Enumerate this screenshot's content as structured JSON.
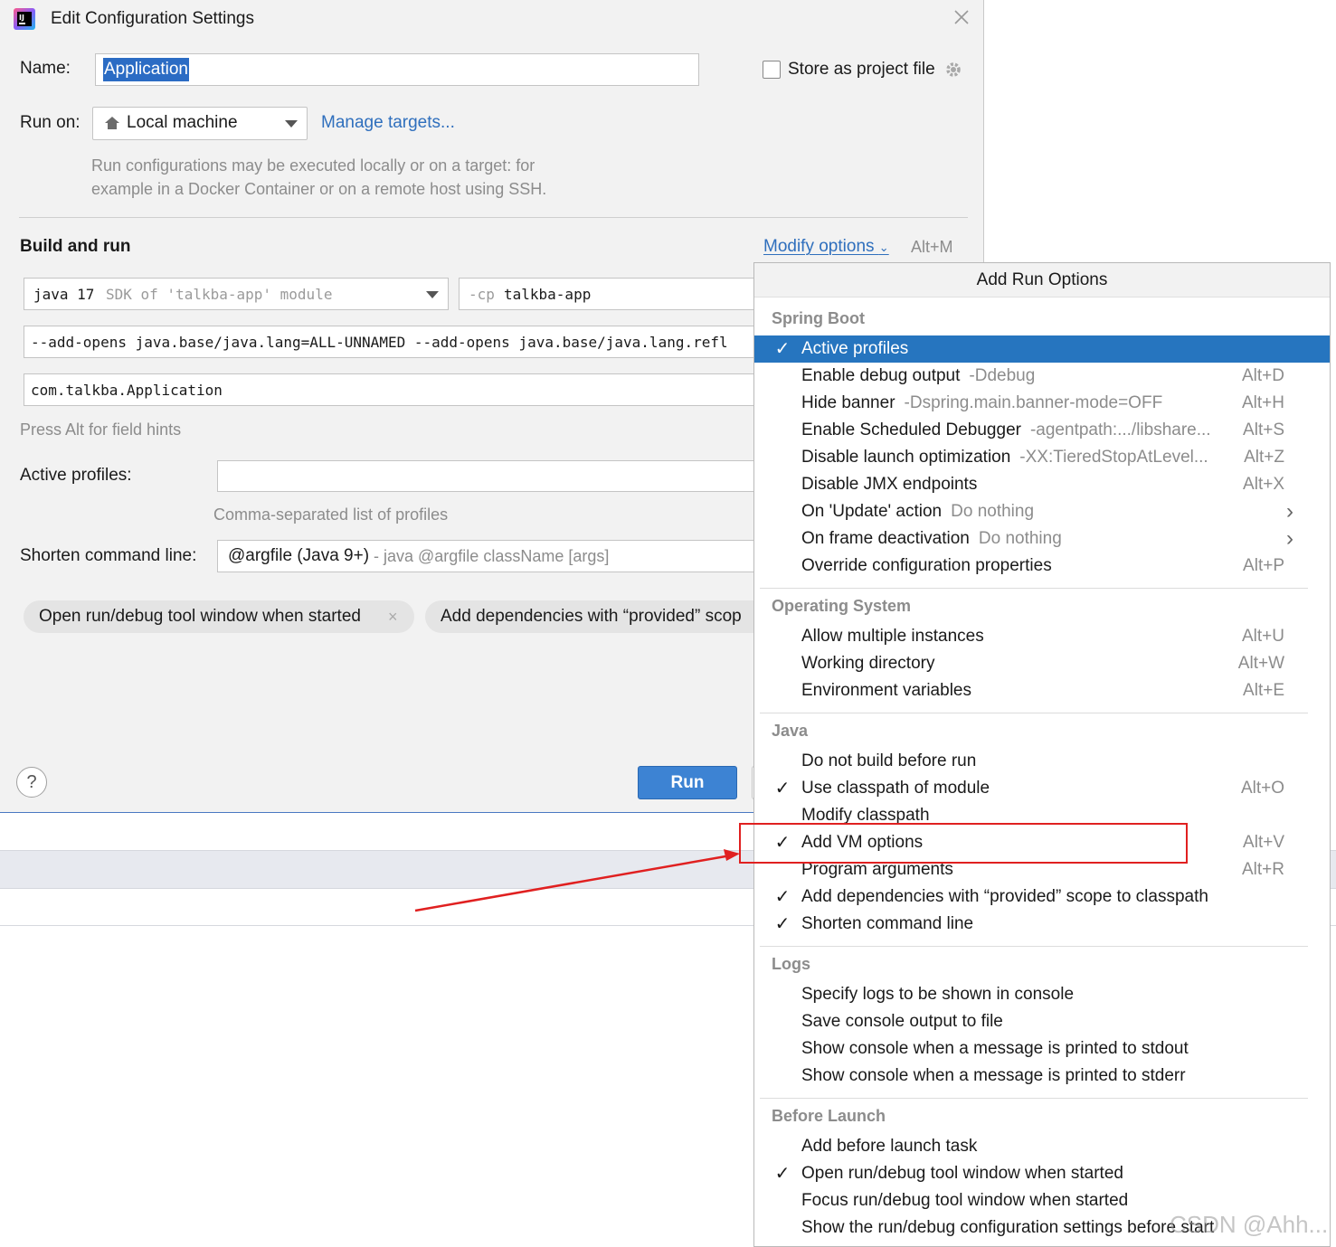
{
  "dialog": {
    "title": "Edit Configuration Settings",
    "name_label": "Name:",
    "name_value": "Application",
    "store_label": "Store as project file",
    "run_on_label": "Run on:",
    "run_on_value": "Local machine",
    "manage_targets": "Manage targets...",
    "run_on_hint_1": "Run configurations may be executed locally or on a target: for",
    "run_on_hint_2": "example in a Docker Container or on a remote host using SSH.",
    "build_run_title": "Build and run",
    "modify_options": "Modify options",
    "modify_shortcut": "Alt+M",
    "sdk_main": "java 17",
    "sdk_hint": "SDK of 'talkba-app' module",
    "cp_prefix": "-cp",
    "cp_value": "talkba-app",
    "vm_options": "--add-opens java.base/java.lang=ALL-UNNAMED --add-opens java.base/java.lang.refl",
    "main_class": "com.talkba.Application",
    "press_alt_hint": "Press Alt for field hints",
    "active_profiles_label": "Active profiles:",
    "active_profiles_value": "",
    "profiles_hint": "Comma-separated list of profiles",
    "shorten_label": "Shorten command line:",
    "shorten_value": "@argfile (Java 9+)",
    "shorten_hint": "- java @argfile className [args]",
    "chip_1": "Open run/debug tool window when started",
    "chip_2": "Add dependencies with “provided” scop",
    "run_button": "Run",
    "help": "?"
  },
  "popup": {
    "title": "Add Run Options",
    "sections": {
      "spring_boot": "Spring Boot",
      "os": "Operating System",
      "java": "Java",
      "logs": "Logs",
      "before_launch": "Before Launch"
    },
    "items": [
      {
        "label": "Active profiles",
        "hint": "",
        "shortcut": "",
        "checked": true
      },
      {
        "label": "Enable debug output",
        "hint": "-Ddebug",
        "shortcut": "Alt+D",
        "checked": false
      },
      {
        "label": "Hide banner",
        "hint": "-Dspring.main.banner-mode=OFF",
        "shortcut": "Alt+H",
        "checked": false
      },
      {
        "label": "Enable Scheduled Debugger",
        "hint": "-agentpath:.../libshare...",
        "shortcut": "Alt+S",
        "checked": false
      },
      {
        "label": "Disable launch optimization",
        "hint": "-XX:TieredStopAtLevel...",
        "shortcut": "Alt+Z",
        "checked": false
      },
      {
        "label": "Disable JMX endpoints",
        "hint": "",
        "shortcut": "Alt+X",
        "checked": false
      },
      {
        "label": "On 'Update' action",
        "hint": "Do nothing",
        "shortcut": "",
        "checked": false
      },
      {
        "label": "On frame deactivation",
        "hint": "Do nothing",
        "shortcut": "",
        "checked": false
      },
      {
        "label": "Override configuration properties",
        "hint": "",
        "shortcut": "Alt+P",
        "checked": false
      },
      {
        "label": "Allow multiple instances",
        "hint": "",
        "shortcut": "Alt+U",
        "checked": false
      },
      {
        "label": "Working directory",
        "hint": "",
        "shortcut": "Alt+W",
        "checked": false
      },
      {
        "label": "Environment variables",
        "hint": "",
        "shortcut": "Alt+E",
        "checked": false
      },
      {
        "label": "Do not build before run",
        "hint": "",
        "shortcut": "",
        "checked": false
      },
      {
        "label": "Use classpath of module",
        "hint": "",
        "shortcut": "Alt+O",
        "checked": true
      },
      {
        "label": "Modify classpath",
        "hint": "",
        "shortcut": "",
        "checked": false
      },
      {
        "label": "Add VM options",
        "hint": "",
        "shortcut": "Alt+V",
        "checked": true
      },
      {
        "label": "Program arguments",
        "hint": "",
        "shortcut": "Alt+R",
        "checked": false
      },
      {
        "label": "Add dependencies with “provided” scope to classpath",
        "hint": "",
        "shortcut": "",
        "checked": true
      },
      {
        "label": "Shorten command line",
        "hint": "",
        "shortcut": "",
        "checked": true
      },
      {
        "label": "Specify logs to be shown in console",
        "hint": "",
        "shortcut": "",
        "checked": false
      },
      {
        "label": "Save console output to file",
        "hint": "",
        "shortcut": "",
        "checked": false
      },
      {
        "label": "Show console when a message is printed to stdout",
        "hint": "",
        "shortcut": "",
        "checked": false
      },
      {
        "label": "Show console when a message is printed to stderr",
        "hint": "",
        "shortcut": "",
        "checked": false
      },
      {
        "label": "Add before launch task",
        "hint": "",
        "shortcut": "",
        "checked": false
      },
      {
        "label": "Open run/debug tool window when started",
        "hint": "",
        "shortcut": "",
        "checked": true
      },
      {
        "label": "Focus run/debug tool window when started",
        "hint": "",
        "shortcut": "",
        "checked": false
      },
      {
        "label": "Show the run/debug configuration settings before start",
        "hint": "",
        "shortcut": "",
        "checked": false
      }
    ]
  },
  "watermark": "CSDN @Ahh...",
  "colors": {
    "accent": "#2675bf",
    "link": "#2f6fbd",
    "highlight_box": "#e02020",
    "dialog_bg": "#f2f2f2"
  }
}
